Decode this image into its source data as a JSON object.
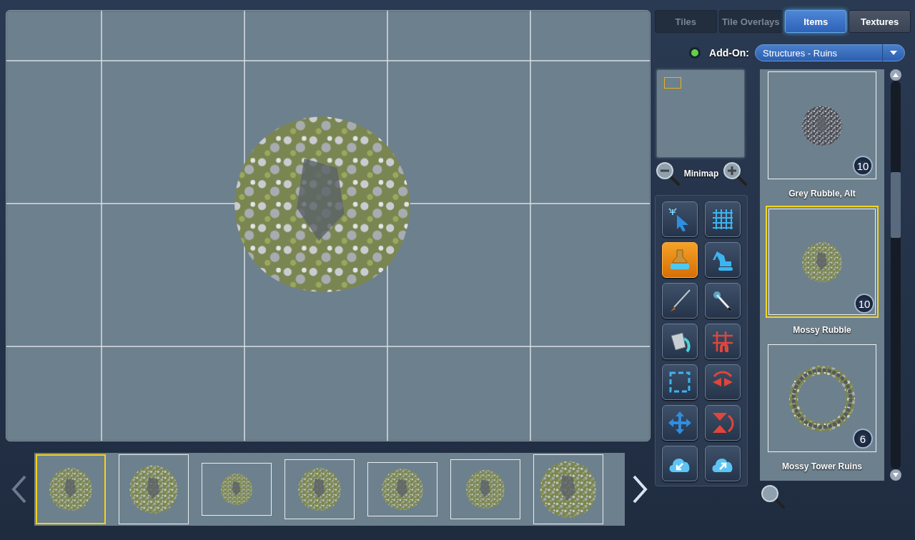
{
  "tabs": [
    {
      "label": "Tiles",
      "selected": false,
      "disabled": true
    },
    {
      "label": "Tile Overlays",
      "selected": false,
      "disabled": true
    },
    {
      "label": "Items",
      "selected": true,
      "disabled": false
    },
    {
      "label": "Textures",
      "selected": false,
      "disabled": false
    }
  ],
  "addon": {
    "on": true,
    "label": "Add-On:",
    "value": "Structures - Ruins"
  },
  "minimap": {
    "label": "Minimap"
  },
  "tools": [
    {
      "kind": "pointer",
      "selected": false
    },
    {
      "kind": "grid",
      "selected": false
    },
    {
      "kind": "stamp",
      "selected": true
    },
    {
      "kind": "excavator",
      "selected": false
    },
    {
      "kind": "brush",
      "selected": false
    },
    {
      "kind": "wand",
      "selected": false
    },
    {
      "kind": "bucket",
      "selected": false
    },
    {
      "kind": "snap",
      "selected": false
    },
    {
      "kind": "marquee",
      "selected": false
    },
    {
      "kind": "flip-h",
      "selected": false
    },
    {
      "kind": "move",
      "selected": false
    },
    {
      "kind": "flip-v",
      "selected": false
    },
    {
      "kind": "import",
      "selected": false
    },
    {
      "kind": "export",
      "selected": false
    }
  ],
  "items": [
    {
      "name": "Grey Rubble, Alt",
      "count": "10",
      "selected": false,
      "kind": "grey"
    },
    {
      "name": "Mossy Rubble",
      "count": "10",
      "selected": true,
      "kind": "mossy"
    },
    {
      "name": "Mossy Tower Ruins",
      "count": "6",
      "selected": false,
      "kind": "ring"
    }
  ],
  "variations": [
    {
      "selected": true
    },
    {
      "selected": false
    },
    {
      "selected": false
    },
    {
      "selected": false
    },
    {
      "selected": false
    },
    {
      "selected": false
    },
    {
      "selected": false
    }
  ]
}
